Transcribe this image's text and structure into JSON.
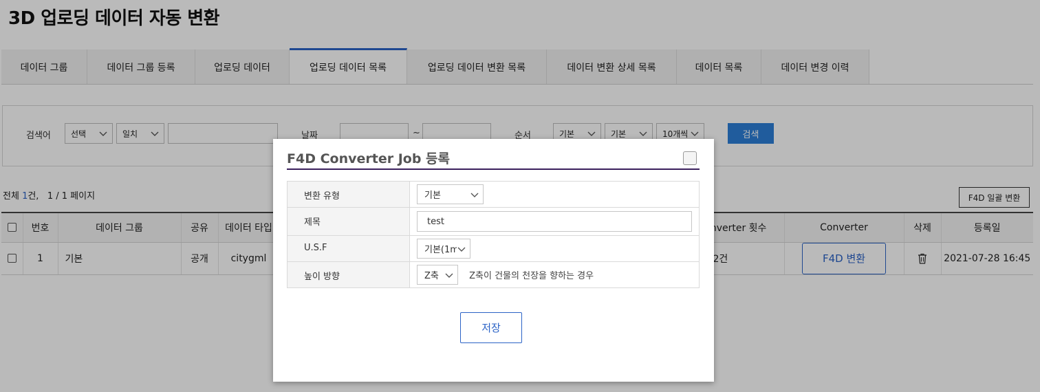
{
  "page": {
    "title": "3D 업로딩 데이터 자동 변환"
  },
  "tabs": [
    {
      "label": "데이터 그룹"
    },
    {
      "label": "데이터 그룹 등록"
    },
    {
      "label": "업로딩 데이터"
    },
    {
      "label": "업로딩 데이터 목록",
      "active": true
    },
    {
      "label": "업로딩 데이터 변환 목록"
    },
    {
      "label": "데이터 변환 상세 목록"
    },
    {
      "label": "데이터 목록"
    },
    {
      "label": "데이터 변경 이력"
    }
  ],
  "search": {
    "keyword_label": "검색어",
    "field_select": "선택",
    "match_select": "일치",
    "keyword_value": "",
    "date_label": "날짜",
    "date_from": "",
    "date_sep": "~",
    "date_to": "",
    "order_label": "순서",
    "order_by": "기본",
    "order_dir": "기본",
    "page_size": "10개씩",
    "button": "검색"
  },
  "summary": {
    "prefix": "전체",
    "count": "1",
    "suffix": "건,",
    "pages": "1 / 1 페이지",
    "bulk_button": "F4D 일괄 변환"
  },
  "table": {
    "headers": {
      "num": "번호",
      "group": "데이터 그룹",
      "share": "공유",
      "type": "데이터 타입",
      "conv_count": "Converter 횟수",
      "converter": "Converter",
      "delete": "삭제",
      "date": "등록일"
    },
    "rows": [
      {
        "num": "1",
        "group": "기본",
        "share": "공개",
        "type": "citygml",
        "conv_count": "2건",
        "converter_button": "F4D 변환",
        "date": "2021-07-28 16:45"
      }
    ]
  },
  "modal": {
    "title": "F4D Converter Job 등록",
    "fields": {
      "conv_type_label": "변환 유형",
      "conv_type_value": "기본",
      "title_label": "제목",
      "title_value": "test",
      "usf_label": "U.S.F",
      "usf_value": "기본(1m",
      "height_label": "높이 방향",
      "height_value": "Z축",
      "height_hint": "Z축이 건물의 천장을 향하는 경우"
    },
    "save_button": "저장"
  }
}
